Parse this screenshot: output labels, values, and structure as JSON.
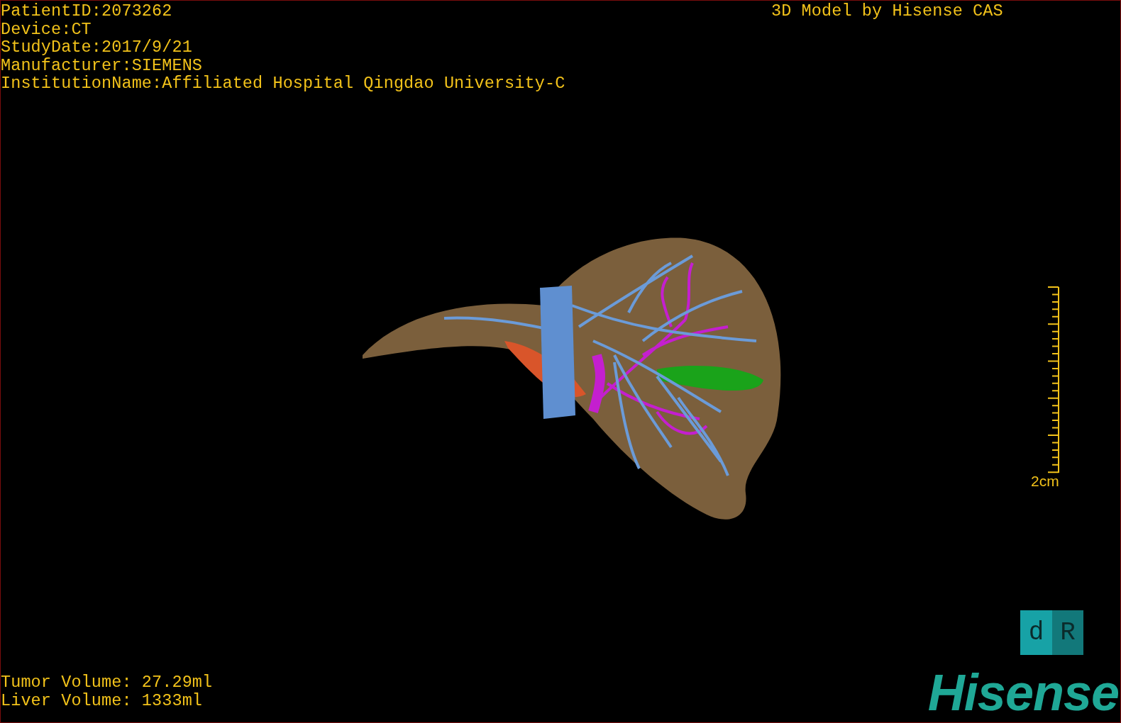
{
  "patient_info": [
    "PatientID:2073262",
    "Device:CT",
    "StudyDate:2017/9/21",
    "Manufacturer:SIEMENS",
    "InstitutionName:Affiliated Hospital Qingdao University-C"
  ],
  "model_credit": "3D Model by Hisense CAS",
  "scale_bar": {
    "label": "2cm"
  },
  "orientation_cube": {
    "faces": [
      "d",
      "R"
    ]
  },
  "volumes": [
    "Tumor Volume: 27.29ml",
    "Liver Volume: 1333ml"
  ],
  "logo": "Hisense"
}
